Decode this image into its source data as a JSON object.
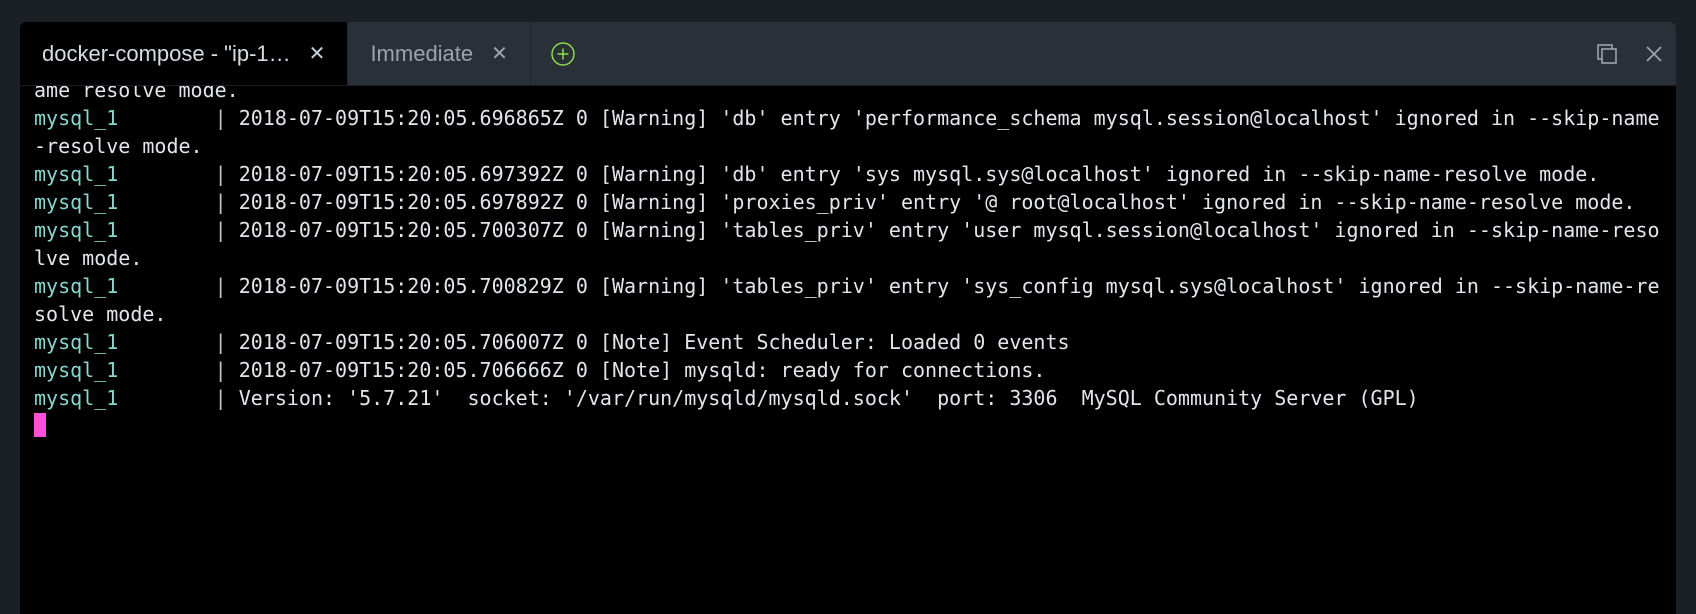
{
  "tabs": [
    {
      "label": "docker-compose - \"ip-1…",
      "active": true
    },
    {
      "label": "Immediate",
      "active": false
    }
  ],
  "top_cut_line": "ame resolve mode.",
  "logs": [
    {
      "service": "mysql_1",
      "text": "2018-07-09T15:20:05.696865Z 0 [Warning] 'db' entry 'performance_schema mysql.session@localhost' ignored in --skip-name-resolve mode."
    },
    {
      "service": "mysql_1",
      "text": "2018-07-09T15:20:05.697392Z 0 [Warning] 'db' entry 'sys mysql.sys@localhost' ignored in --skip-name-resolve mode."
    },
    {
      "service": "mysql_1",
      "text": "2018-07-09T15:20:05.697892Z 0 [Warning] 'proxies_priv' entry '@ root@localhost' ignored in --skip-name-resolve mode."
    },
    {
      "service": "mysql_1",
      "text": "2018-07-09T15:20:05.700307Z 0 [Warning] 'tables_priv' entry 'user mysql.session@localhost' ignored in --skip-name-resolve mode."
    },
    {
      "service": "mysql_1",
      "text": "2018-07-09T15:20:05.700829Z 0 [Warning] 'tables_priv' entry 'sys_config mysql.sys@localhost' ignored in --skip-name-resolve mode."
    },
    {
      "service": "mysql_1",
      "text": "2018-07-09T15:20:05.706007Z 0 [Note] Event Scheduler: Loaded 0 events"
    },
    {
      "service": "mysql_1",
      "text": "2018-07-09T15:20:05.706666Z 0 [Note] mysqld: ready for connections."
    },
    {
      "service": "mysql_1",
      "text": "Version: '5.7.21'  socket: '/var/run/mysqld/mysqld.sock'  port: 3306  MySQL Community Server (GPL)"
    }
  ],
  "service_col_width": 14,
  "colors": {
    "service": "#87d6d0",
    "text": "#e2e6ea",
    "cursor": "#ff4fd8",
    "add_ring": "#8bdc4f"
  }
}
